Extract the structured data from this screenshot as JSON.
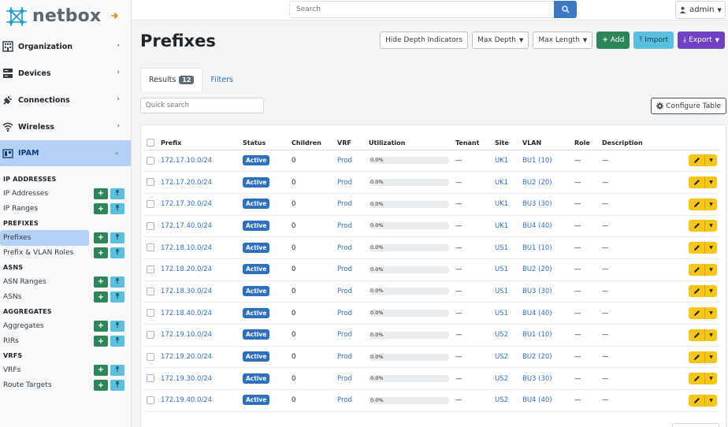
{
  "brand": {
    "name": "netbox"
  },
  "topbar": {
    "search_placeholder": "Search",
    "user": "admin"
  },
  "sidebar": {
    "sections": [
      {
        "label": "Organization",
        "icon": "building-icon"
      },
      {
        "label": "Devices",
        "icon": "server-icon"
      },
      {
        "label": "Connections",
        "icon": "plug-icon"
      },
      {
        "label": "Wireless",
        "icon": "wifi-icon"
      },
      {
        "label": "IPAM",
        "icon": "ipam-icon"
      }
    ],
    "ipam_groups": [
      {
        "heading": "IP ADDRESSES",
        "items": [
          "IP Addresses",
          "IP Ranges"
        ]
      },
      {
        "heading": "PREFIXES",
        "items": [
          "Prefixes",
          "Prefix & VLAN Roles"
        ]
      },
      {
        "heading": "ASNS",
        "items": [
          "ASN Ranges",
          "ASNs"
        ]
      },
      {
        "heading": "AGGREGATES",
        "items": [
          "Aggregates",
          "RIRs"
        ]
      },
      {
        "heading": "VRFS",
        "items": [
          "VRFs",
          "Route Targets"
        ]
      }
    ]
  },
  "page": {
    "title": "Prefixes",
    "buttons": {
      "hide_depth": "Hide Depth Indicators",
      "max_depth": "Max Depth",
      "max_length": "Max Length",
      "add": "Add",
      "import": "Import",
      "export": "Export"
    },
    "tabs": {
      "results": "Results",
      "results_count": "12",
      "filters": "Filters"
    },
    "quick_search_placeholder": "Quick search",
    "configure_table": "Configure Table"
  },
  "table": {
    "columns": [
      "Prefix",
      "Status",
      "Children",
      "VRF",
      "Utilization",
      "Tenant",
      "Site",
      "VLAN",
      "Role",
      "Description"
    ],
    "rows": [
      {
        "prefix": "172.17.10.0/24",
        "status": "Active",
        "children": "0",
        "vrf": "Prod",
        "utilization": "0.0%",
        "util_fraction": 0.0,
        "tenant": "—",
        "site": "UK1",
        "vlan": "BU1 (10)",
        "role": "—",
        "description": "—"
      },
      {
        "prefix": "172.17.20.0/24",
        "status": "Active",
        "children": "0",
        "vrf": "Prod",
        "utilization": "0.0%",
        "util_fraction": 0.0,
        "tenant": "—",
        "site": "UK1",
        "vlan": "BU2 (20)",
        "role": "—",
        "description": "—"
      },
      {
        "prefix": "172.17.30.0/24",
        "status": "Active",
        "children": "0",
        "vrf": "Prod",
        "utilization": "0.0%",
        "util_fraction": 0.0,
        "tenant": "—",
        "site": "UK1",
        "vlan": "BU3 (30)",
        "role": "—",
        "description": "—"
      },
      {
        "prefix": "172.17.40.0/24",
        "status": "Active",
        "children": "0",
        "vrf": "Prod",
        "utilization": "0.0%",
        "util_fraction": 0.0,
        "tenant": "—",
        "site": "UK1",
        "vlan": "BU4 (40)",
        "role": "—",
        "description": "—"
      },
      {
        "prefix": "172.18.10.0/24",
        "status": "Active",
        "children": "0",
        "vrf": "Prod",
        "utilization": "0.0%",
        "util_fraction": 0.0,
        "tenant": "—",
        "site": "US1",
        "vlan": "BU1 (10)",
        "role": "—",
        "description": "—"
      },
      {
        "prefix": "172.18.20.0/24",
        "status": "Active",
        "children": "0",
        "vrf": "Prod",
        "utilization": "0.0%",
        "util_fraction": 0.0,
        "tenant": "—",
        "site": "US1",
        "vlan": "BU2 (20)",
        "role": "—",
        "description": "—"
      },
      {
        "prefix": "172.18.30.0/24",
        "status": "Active",
        "children": "0",
        "vrf": "Prod",
        "utilization": "0.0%",
        "util_fraction": 0.0,
        "tenant": "—",
        "site": "US1",
        "vlan": "BU3 (30)",
        "role": "—",
        "description": "—"
      },
      {
        "prefix": "172.18.40.0/24",
        "status": "Active",
        "children": "0",
        "vrf": "Prod",
        "utilization": "0.0%",
        "util_fraction": 0.0,
        "tenant": "—",
        "site": "US1",
        "vlan": "BU4 (40)",
        "role": "—",
        "description": "—"
      },
      {
        "prefix": "172.19.10.0/24",
        "status": "Active",
        "children": "0",
        "vrf": "Prod",
        "utilization": "0.0%",
        "util_fraction": 0.0,
        "tenant": "—",
        "site": "US2",
        "vlan": "BU1 (10)",
        "role": "—",
        "description": "—"
      },
      {
        "prefix": "172.19.20.0/24",
        "status": "Active",
        "children": "0",
        "vrf": "Prod",
        "utilization": "0.0%",
        "util_fraction": 0.0,
        "tenant": "—",
        "site": "US2",
        "vlan": "BU2 (20)",
        "role": "—",
        "description": "—"
      },
      {
        "prefix": "172.19.30.0/24",
        "status": "Active",
        "children": "0",
        "vrf": "Prod",
        "utilization": "0.0%",
        "util_fraction": 0.0,
        "tenant": "—",
        "site": "US2",
        "vlan": "BU3 (30)",
        "role": "—",
        "description": "—"
      },
      {
        "prefix": "172.19.40.0/24",
        "status": "Active",
        "children": "0",
        "vrf": "Prod",
        "utilization": "0.0%",
        "util_fraction": 0.0,
        "tenant": "—",
        "site": "US2",
        "vlan": "BU4 (40)",
        "role": "—",
        "description": "—"
      }
    ]
  },
  "colors": {
    "accent_blue": "#2f6fbf",
    "sidebar_active": "#b5d0f5",
    "add_green": "#2f855a",
    "import_cyan": "#5bc0de",
    "export_purple": "#6f42c1",
    "edit_yellow": "#f5c518"
  }
}
